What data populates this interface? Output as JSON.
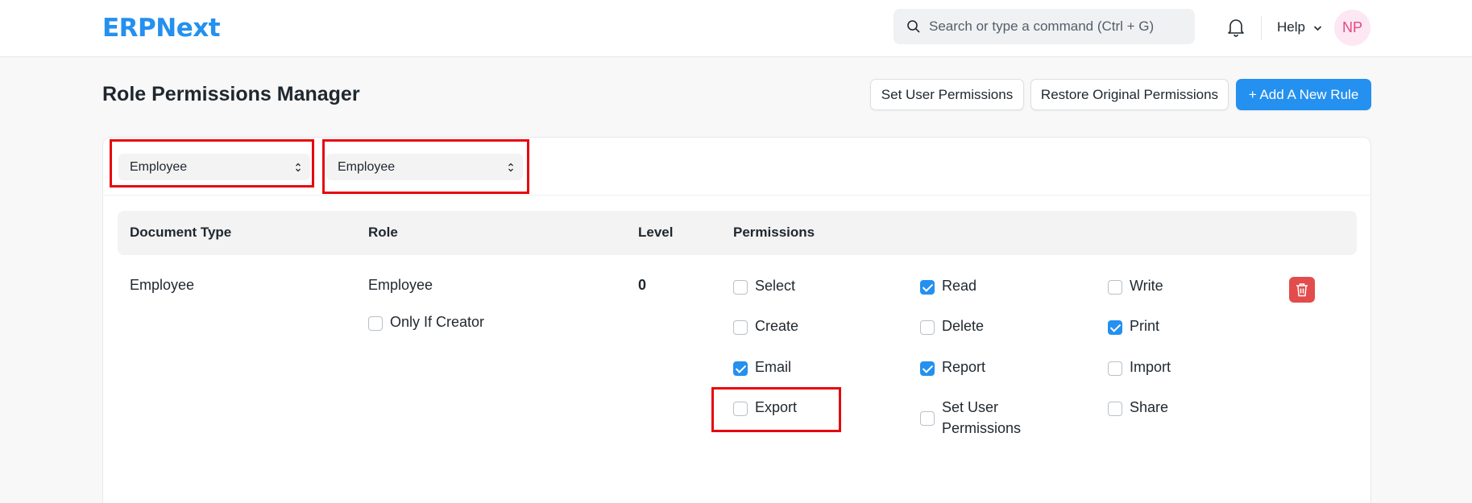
{
  "navbar": {
    "logo": "ERPNext",
    "search_placeholder": "Search or type a command (Ctrl + G)",
    "search_icon": "search-icon",
    "notifications_icon": "bell-icon",
    "help_label": "Help",
    "avatar_initials": "NP"
  },
  "page": {
    "title": "Role Permissions Manager",
    "buttons": {
      "set_user_permissions": "Set User Permissions",
      "restore_original": "Restore Original Permissions",
      "add_new_rule": "+ Add A New Rule"
    }
  },
  "filters": {
    "doctype_selected": "Employee",
    "role_selected": "Employee"
  },
  "table": {
    "headers": {
      "document_type": "Document Type",
      "role": "Role",
      "level": "Level",
      "permissions": "Permissions"
    },
    "rows": [
      {
        "document_type": "Employee",
        "role": "Employee",
        "level": "0",
        "only_if_creator": {
          "label": "Only If Creator",
          "checked": false
        },
        "permissions": [
          {
            "label": "Select",
            "checked": false
          },
          {
            "label": "Read",
            "checked": true
          },
          {
            "label": "Write",
            "checked": false
          },
          {
            "label": "Create",
            "checked": false
          },
          {
            "label": "Delete",
            "checked": false
          },
          {
            "label": "Print",
            "checked": true
          },
          {
            "label": "Email",
            "checked": true
          },
          {
            "label": "Report",
            "checked": true
          },
          {
            "label": "Import",
            "checked": false
          },
          {
            "label": "Export",
            "checked": false
          },
          {
            "label": "Set User Permissions",
            "checked": false
          },
          {
            "label": "Share",
            "checked": false
          }
        ],
        "delete_icon": "trash-icon"
      }
    ]
  },
  "colors": {
    "brand": "#2490ef",
    "danger": "#e24c4c",
    "highlight_box": "#e5080f",
    "avatar_bg": "#fce7f3",
    "avatar_text": "#e5487f"
  }
}
